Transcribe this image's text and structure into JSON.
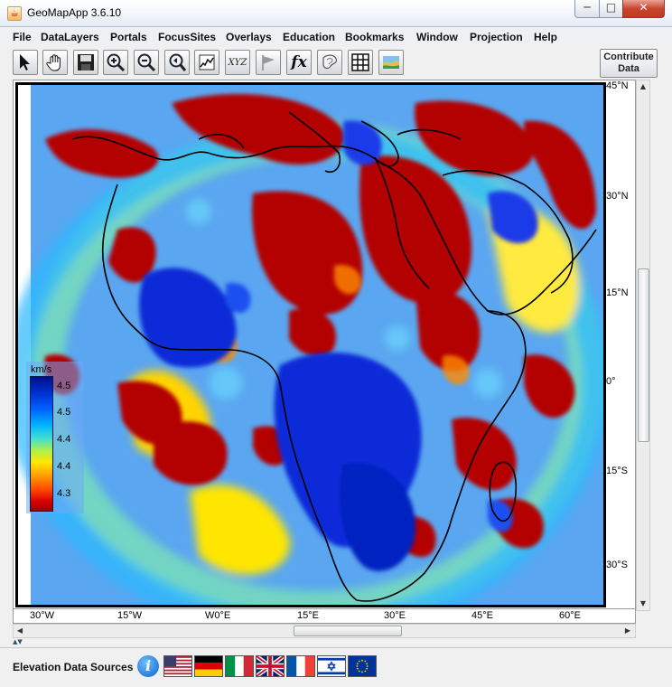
{
  "window": {
    "title": "GeoMapApp 3.6.10",
    "min_glyph": "─",
    "max_glyph": "□",
    "close_glyph": "✕"
  },
  "menu": [
    "File",
    "DataLayers",
    "Portals",
    "FocusSites",
    "Overlays",
    "Education",
    "Bookmarks",
    "Window",
    "Projection",
    "Help"
  ],
  "toolbar": {
    "tools": [
      "select-arrow",
      "pan-hand",
      "save-disk",
      "zoom-in",
      "zoom-out",
      "zoom-back",
      "profile-graph",
      "xyz-grid",
      "flag",
      "fx-function",
      "contour-tool",
      "grid-toggle",
      "layers-map"
    ],
    "contribute_label": "Contribute Data",
    "fx_label": "fx",
    "xyz_label": "XYZ"
  },
  "map": {
    "lat_labels": [
      "45°N",
      "30°N",
      "15°N",
      "0°",
      "15°S",
      "30°S"
    ],
    "lon_labels": [
      "30°W",
      "15°W",
      "W0°E",
      "15°E",
      "30°E",
      "45°E",
      "60°E"
    ]
  },
  "legend": {
    "unit": "km/s",
    "ticks": [
      "4.5",
      "4.5",
      "4.4",
      "4.4",
      "4.3"
    ]
  },
  "bottom": {
    "elevation_label": "Elevation Data Sources",
    "info_glyph": "i",
    "flags": [
      "usa-flag",
      "germany-flag",
      "italy-flag",
      "uk-flag",
      "france-flag",
      "israel-flag",
      "eu-flag"
    ]
  }
}
